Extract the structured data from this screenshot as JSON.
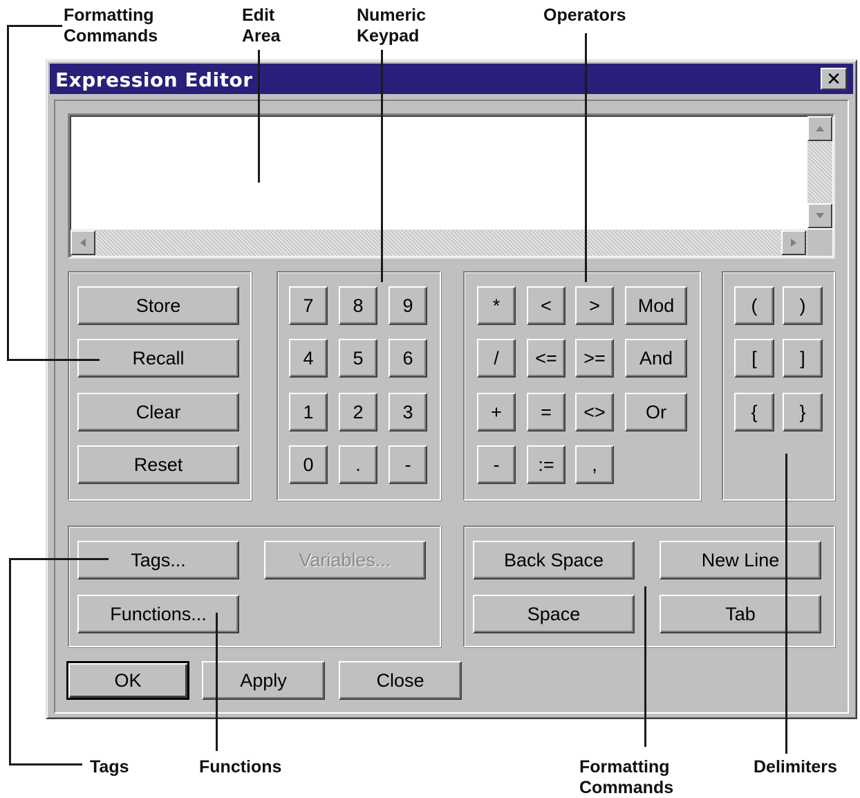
{
  "callouts": {
    "formatting_top": "Formatting\nCommands",
    "edit_area": "Edit\nArea",
    "numeric_keypad": "Numeric\nKeypad",
    "operators": "Operators",
    "tags": "Tags",
    "functions": "Functions",
    "formatting_bottom": "Formatting\nCommands",
    "delimiters": "Delimiters"
  },
  "window": {
    "title": "Expression Editor",
    "close_glyph": "✕",
    "edit_value": ""
  },
  "icons": {
    "close": "close-icon",
    "scroll_up": "arrow-up-icon",
    "scroll_down": "arrow-down-icon",
    "scroll_left": "arrow-left-icon",
    "scroll_right": "arrow-right-icon"
  },
  "memory": {
    "store": "Store",
    "recall": "Recall",
    "clear": "Clear",
    "reset": "Reset"
  },
  "keypad": {
    "k7": "7",
    "k8": "8",
    "k9": "9",
    "k4": "4",
    "k5": "5",
    "k6": "6",
    "k1": "1",
    "k2": "2",
    "k3": "3",
    "k0": "0",
    "kdot": ".",
    "kminus": "-"
  },
  "operators": {
    "multiply": "*",
    "lt": "<",
    "gt": ">",
    "mod": "Mod",
    "divide": "/",
    "le": "<=",
    "ge": ">=",
    "and": "And",
    "plus": "+",
    "eq": "=",
    "ne": "<>",
    "or": "Or",
    "minus": "-",
    "assign": ":=",
    "comma": ","
  },
  "delimiters": {
    "lparen": "(",
    "rparen": ")",
    "lbracket": "[",
    "rbracket": "]",
    "lbrace": "{",
    "rbrace": "}"
  },
  "lookup": {
    "tags": "Tags...",
    "variables": "Variables...",
    "functions": "Functions..."
  },
  "formatting": {
    "backspace": "Back Space",
    "newline": "New Line",
    "space": "Space",
    "tab": "Tab"
  },
  "dialog": {
    "ok": "OK",
    "apply": "Apply",
    "close": "Close"
  },
  "colors": {
    "titlebar": "#28207a",
    "face": "#c0c0c0",
    "disabled_text": "#8a8a8a"
  }
}
